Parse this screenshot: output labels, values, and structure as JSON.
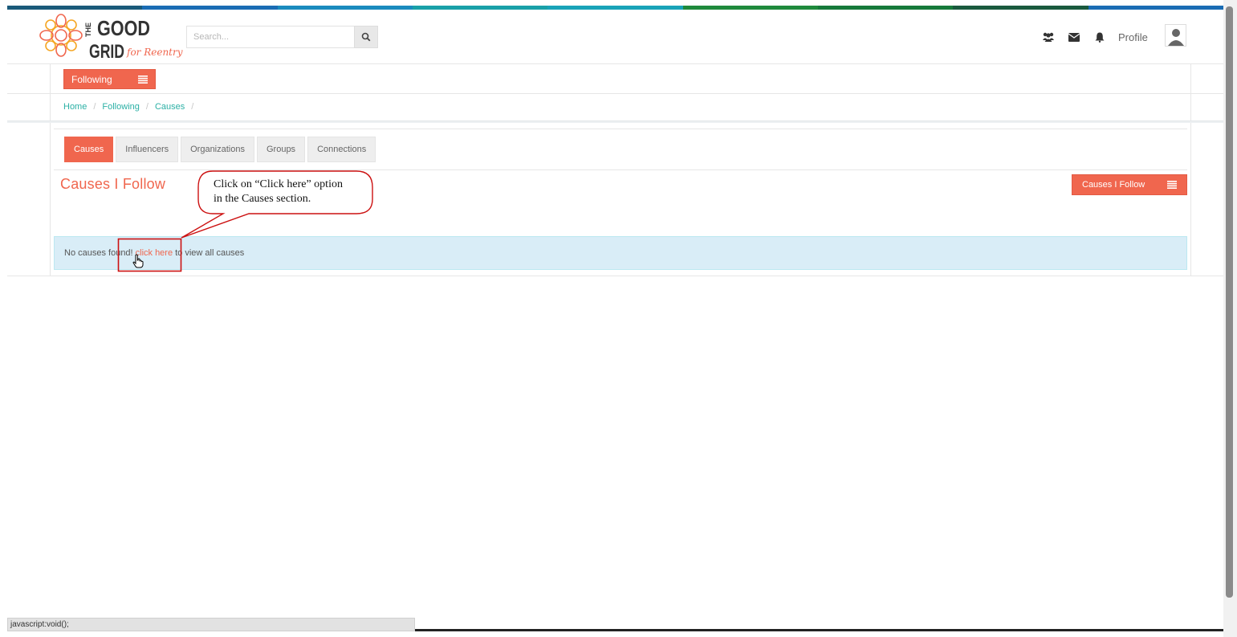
{
  "topbar_colors": [
    "#1a5a7a",
    "#1a6cb4",
    "#1b8bbe",
    "#19a0a8",
    "#19a3b8",
    "#1f8a3c",
    "#177a3a",
    "#1a5a3e",
    "#1a6cb4"
  ],
  "brand": {
    "logo_text_1": "THE",
    "logo_text_2": "GOOD",
    "logo_text_3": "GRID",
    "logo_tagline": "for Reentry",
    "accent": "#f0664e",
    "link": "#2bb0a5"
  },
  "search": {
    "placeholder": "Search..."
  },
  "header": {
    "profile_label": "Profile",
    "icons": [
      "users-icon",
      "envelope-icon",
      "bell-icon"
    ]
  },
  "following_menu": {
    "label": "Following"
  },
  "breadcrumb": {
    "items": [
      "Home",
      "Following",
      "Causes"
    ]
  },
  "tabs": [
    {
      "label": "Causes",
      "active": true
    },
    {
      "label": "Influencers",
      "active": false
    },
    {
      "label": "Organizations",
      "active": false
    },
    {
      "label": "Groups",
      "active": false
    },
    {
      "label": "Connections",
      "active": false
    }
  ],
  "section": {
    "title": "Causes I Follow",
    "menu_button_label": "Causes I Follow"
  },
  "alert": {
    "prefix": "No causes found!",
    "link_text": "click here",
    "suffix": "to view all causes"
  },
  "callout": {
    "line1": "Click on “Click here” option",
    "line2": "in the Causes section."
  },
  "statusbar": {
    "text": "javascript:void();"
  }
}
